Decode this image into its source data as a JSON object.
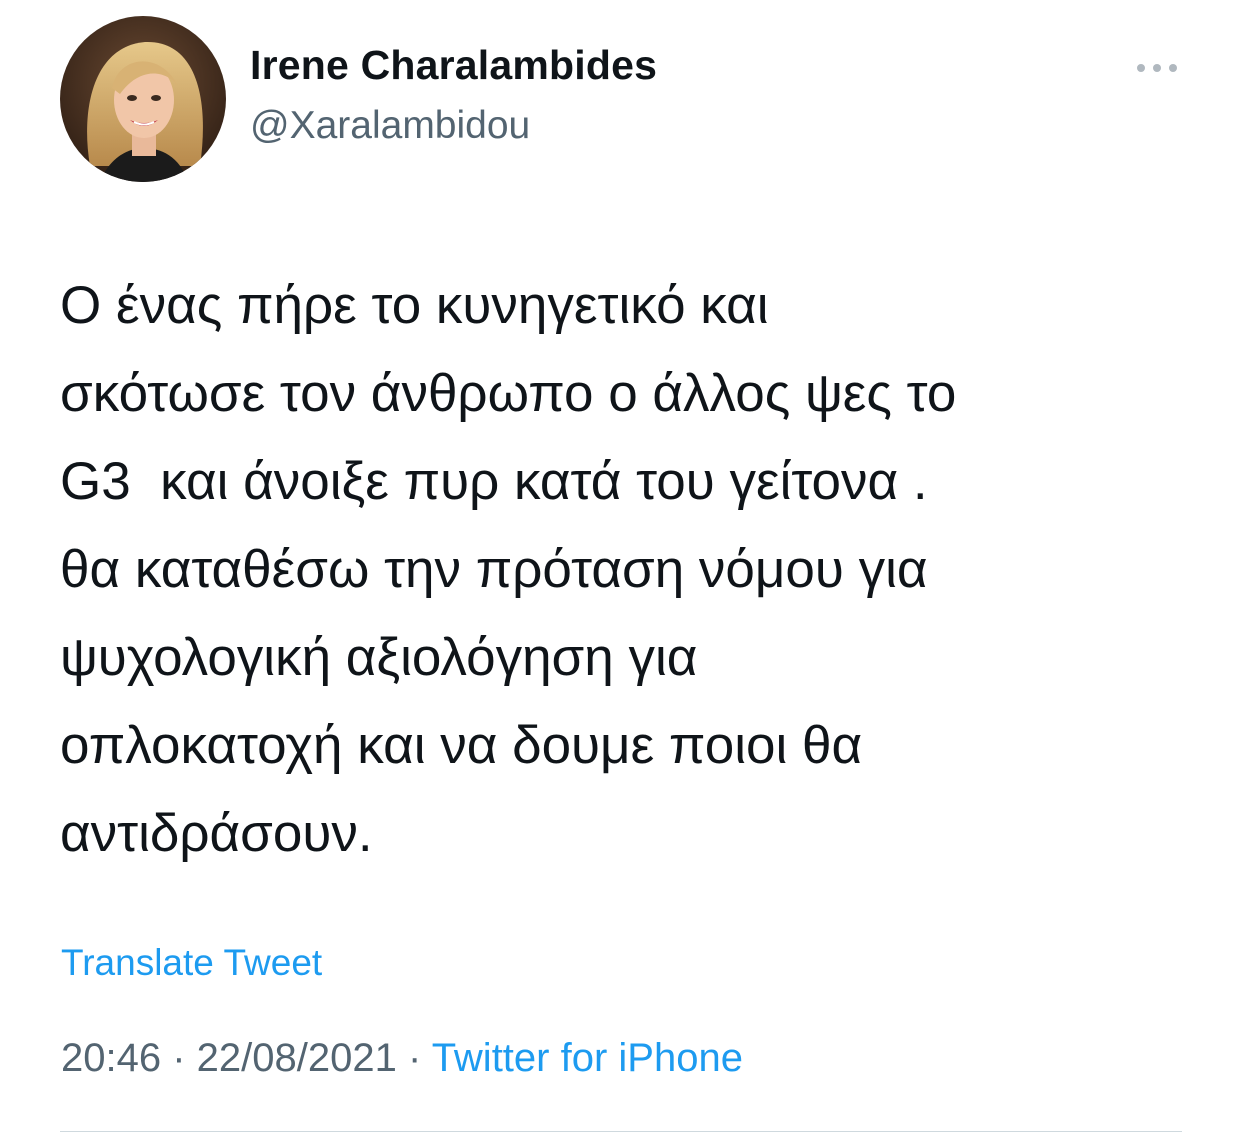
{
  "author": {
    "display_name": "Irene Charalambides",
    "handle": "@Xaralambidou",
    "avatar_icon": "profile-photo-avatar"
  },
  "menu": {
    "icon": "more-horizontal-icon"
  },
  "tweet": {
    "text": "Ο ένας πήρε το κυνηγετικό και\nσκότωσε τον άνθρωπο ο άλλος ψες το\nG3  και άνοιξε πυρ κατά του γείτονα .\nθα καταθέσω την πρόταση νόμου για\nψυχολογική αξιολόγηση για\nοπλοκατοχή και να δουμε ποιοι θα\nαντιδράσουν.",
    "translate_label": "Translate Tweet"
  },
  "meta": {
    "time": "20:46",
    "separator": " · ",
    "date": "22/08/2021",
    "source": "Twitter for iPhone"
  },
  "colors": {
    "link": "#1d9bf0",
    "secondary_text": "#536471",
    "primary_text": "#0f1419",
    "divider": "#cfd9de"
  }
}
